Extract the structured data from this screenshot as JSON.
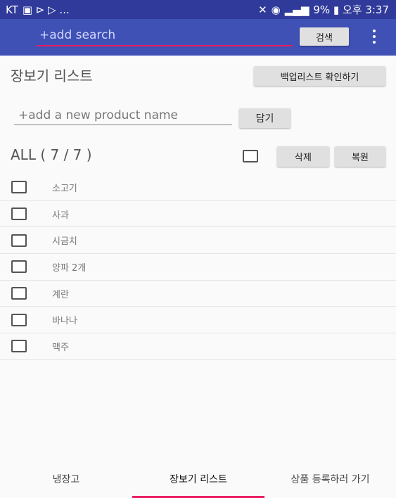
{
  "status_bar": {
    "carrier": "KT",
    "left_icons_text": "▣ ⊳ ▷ ...",
    "right_text": "9% ▮ 오후 3:37"
  },
  "app_bar": {
    "search_placeholder": "+add search",
    "search_button": "검색",
    "menu_icon": "overflow-menu-icon"
  },
  "list": {
    "title": "장보기 리스트",
    "backup_button": "백업리스트 확인하기",
    "product_placeholder": "+add a new product name",
    "add_button": "담기",
    "count_label": "ALL ( 7 / 7 )",
    "delete_button": "삭제",
    "restore_button": "복원",
    "items": [
      {
        "label": "소고기"
      },
      {
        "label": "사과"
      },
      {
        "label": "시금치"
      },
      {
        "label": "양파 2개"
      },
      {
        "label": "계란"
      },
      {
        "label": "바나나"
      },
      {
        "label": "맥주"
      }
    ]
  },
  "bottom_nav": {
    "tabs": [
      {
        "label": "냉장고"
      },
      {
        "label": "장보기 리스트"
      },
      {
        "label": "상품 등록하러 가기"
      }
    ],
    "active_index": 1
  },
  "colors": {
    "status_bar": "#2f3a9a",
    "app_bar": "#3f51b5",
    "accent": "#e91e63"
  }
}
